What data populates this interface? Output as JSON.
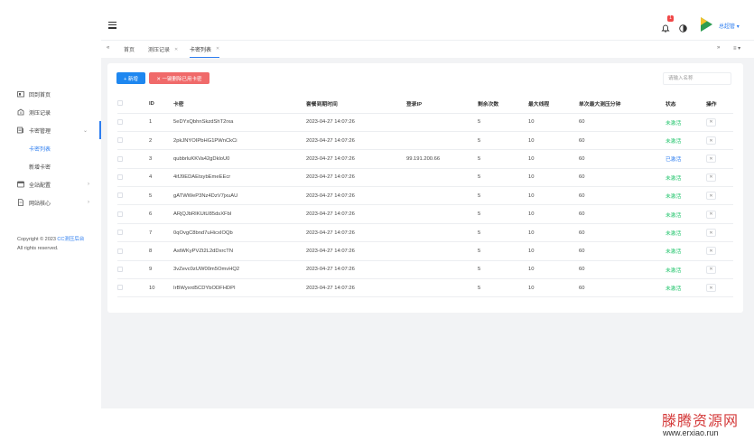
{
  "header": {
    "notification_count": "1",
    "username": "总超管",
    "username_arrow": "▾"
  },
  "sidebar": {
    "items": [
      {
        "label": "回到首页",
        "icon": "home-icon"
      },
      {
        "label": "测压记录",
        "icon": "record-icon"
      },
      {
        "label": "卡密管理",
        "icon": "card-icon",
        "expanded": true
      },
      {
        "label": "全站配置",
        "icon": "settings-icon"
      },
      {
        "label": "网站核心",
        "icon": "file-icon"
      }
    ],
    "subitems": [
      {
        "label": "卡密列表",
        "active": true
      },
      {
        "label": "新增卡密",
        "active": false
      }
    ],
    "copyright_prefix": "Copyright © 2023",
    "copyright_link": "CC测压后台",
    "copyright_suffix": "All rights reserved."
  },
  "tabs": {
    "items": [
      {
        "label": "首页",
        "closable": false
      },
      {
        "label": "测压记录",
        "closable": true
      },
      {
        "label": "卡密列表",
        "closable": true,
        "active": true
      }
    ]
  },
  "toolbar": {
    "add_label": "+ 新增",
    "delete_label": "✕ 一键删除已用卡密",
    "search_placeholder": "请输入名称"
  },
  "table": {
    "columns": [
      "ID",
      "卡密",
      "套餐到期时间",
      "登录IP",
      "剩余次数",
      "最大线程",
      "单次最大测压分钟",
      "状态",
      "操作"
    ],
    "rows": [
      {
        "id": "1",
        "card": "5eDYxQbhnSkzdShT2rxa",
        "expire": "2023-04-27 14:07:26",
        "ip": "",
        "remain": "5",
        "threads": "10",
        "minutes": "60",
        "status": "未激活",
        "status_type": "inactive"
      },
      {
        "id": "2",
        "card": "2pkJNYOIPbHG1PWnCkCi",
        "expire": "2023-04-27 14:07:26",
        "ip": "",
        "remain": "5",
        "threads": "10",
        "minutes": "60",
        "status": "未激活",
        "status_type": "inactive"
      },
      {
        "id": "3",
        "card": "qubbrluKKVa42gDkloU0",
        "expire": "2023-04-27 14:07:26",
        "ip": "99.191.200.66",
        "remain": "5",
        "threads": "10",
        "minutes": "60",
        "status": "已激活",
        "status_type": "active"
      },
      {
        "id": "4",
        "card": "4ifJ9EDAEtsybEmeEEcr",
        "expire": "2023-04-27 14:07:26",
        "ip": "",
        "remain": "5",
        "threads": "10",
        "minutes": "60",
        "status": "未激活",
        "status_type": "inactive"
      },
      {
        "id": "5",
        "card": "gATWWeP3Nz4DzV7jxuAU",
        "expire": "2023-04-27 14:07:26",
        "ip": "",
        "remain": "5",
        "threads": "10",
        "minutes": "60",
        "status": "未激活",
        "status_type": "inactive"
      },
      {
        "id": "6",
        "card": "ARjQJbRIKUtU85dsXFbl",
        "expire": "2023-04-27 14:07:26",
        "ip": "",
        "remain": "5",
        "threads": "10",
        "minutes": "60",
        "status": "未激活",
        "status_type": "inactive"
      },
      {
        "id": "7",
        "card": "0qOvgC8bnd7uHicxIOQb",
        "expire": "2023-04-27 14:07:26",
        "ip": "",
        "remain": "5",
        "threads": "10",
        "minutes": "60",
        "status": "未激活",
        "status_type": "inactive"
      },
      {
        "id": "8",
        "card": "AstWKyPVZt2L2dDxrcTN",
        "expire": "2023-04-27 14:07:26",
        "ip": "",
        "remain": "5",
        "threads": "10",
        "minutes": "60",
        "status": "未激活",
        "status_type": "inactive"
      },
      {
        "id": "9",
        "card": "3vZevc0zUW00m5OmvHQ2",
        "expire": "2023-04-27 14:07:26",
        "ip": "",
        "remain": "5",
        "threads": "10",
        "minutes": "60",
        "status": "未激活",
        "status_type": "inactive"
      },
      {
        "id": "10",
        "card": "IrBWyxrd5CDYbODFHDPI",
        "expire": "2023-04-27 14:07:26",
        "ip": "",
        "remain": "5",
        "threads": "10",
        "minutes": "60",
        "status": "未激活",
        "status_type": "inactive"
      }
    ],
    "delete_icon": "✕"
  },
  "watermark": {
    "title": "滕腾资源网",
    "url": "www.erxiao.run"
  },
  "colors": {
    "primary": "#1e87f0",
    "danger": "#f06a6a",
    "success": "#1ec46a",
    "background": "#f2f3f5"
  }
}
